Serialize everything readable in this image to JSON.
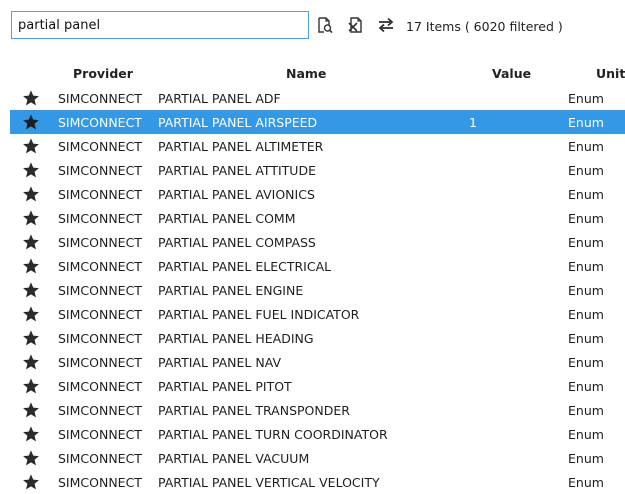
{
  "search": {
    "value": "partial panel"
  },
  "status": {
    "count_text": "17 Items ( 6020 filtered )"
  },
  "columns": {
    "provider": "Provider",
    "name": "Name",
    "value": "Value",
    "unit": "Unit"
  },
  "icons": {
    "toolbar": [
      "search-document-icon",
      "clear-filter-icon",
      "swap-arrows-icon"
    ],
    "row": "star-icon"
  },
  "colors": {
    "selection": "#3399e6",
    "search_border": "#4aa3df"
  },
  "selected_row": 1,
  "rows": [
    {
      "provider": "SIMCONNECT",
      "name": "PARTIAL PANEL ADF",
      "value": "",
      "unit": "Enum"
    },
    {
      "provider": "SIMCONNECT",
      "name": "PARTIAL PANEL AIRSPEED",
      "value": "1",
      "unit": "Enum"
    },
    {
      "provider": "SIMCONNECT",
      "name": "PARTIAL PANEL ALTIMETER",
      "value": "",
      "unit": "Enum"
    },
    {
      "provider": "SIMCONNECT",
      "name": "PARTIAL PANEL ATTITUDE",
      "value": "",
      "unit": "Enum"
    },
    {
      "provider": "SIMCONNECT",
      "name": "PARTIAL PANEL AVIONICS",
      "value": "",
      "unit": "Enum"
    },
    {
      "provider": "SIMCONNECT",
      "name": "PARTIAL PANEL COMM",
      "value": "",
      "unit": "Enum"
    },
    {
      "provider": "SIMCONNECT",
      "name": "PARTIAL PANEL COMPASS",
      "value": "",
      "unit": "Enum"
    },
    {
      "provider": "SIMCONNECT",
      "name": "PARTIAL PANEL ELECTRICAL",
      "value": "",
      "unit": "Enum"
    },
    {
      "provider": "SIMCONNECT",
      "name": "PARTIAL PANEL ENGINE",
      "value": "",
      "unit": "Enum"
    },
    {
      "provider": "SIMCONNECT",
      "name": "PARTIAL PANEL FUEL INDICATOR",
      "value": "",
      "unit": "Enum"
    },
    {
      "provider": "SIMCONNECT",
      "name": "PARTIAL PANEL HEADING",
      "value": "",
      "unit": "Enum"
    },
    {
      "provider": "SIMCONNECT",
      "name": "PARTIAL PANEL NAV",
      "value": "",
      "unit": "Enum"
    },
    {
      "provider": "SIMCONNECT",
      "name": "PARTIAL PANEL PITOT",
      "value": "",
      "unit": "Enum"
    },
    {
      "provider": "SIMCONNECT",
      "name": "PARTIAL PANEL TRANSPONDER",
      "value": "",
      "unit": "Enum"
    },
    {
      "provider": "SIMCONNECT",
      "name": "PARTIAL PANEL TURN COORDINATOR",
      "value": "",
      "unit": "Enum"
    },
    {
      "provider": "SIMCONNECT",
      "name": "PARTIAL PANEL VACUUM",
      "value": "",
      "unit": "Enum"
    },
    {
      "provider": "SIMCONNECT",
      "name": "PARTIAL PANEL VERTICAL VELOCITY",
      "value": "",
      "unit": "Enum"
    }
  ]
}
